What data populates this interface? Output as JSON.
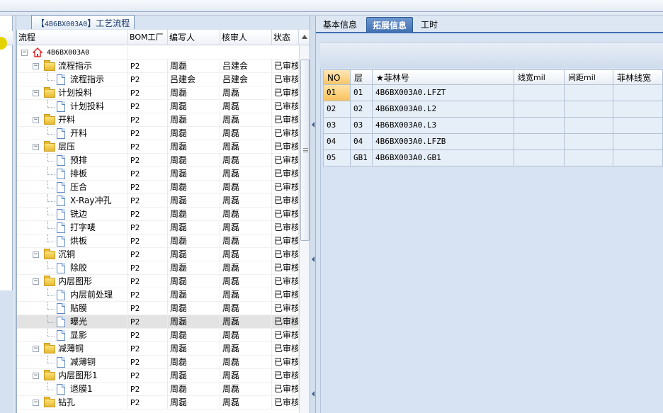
{
  "tree_tab": {
    "code": "4B6BX003A0",
    "title": "工艺流程",
    "prefix": "【",
    "suffix": "】"
  },
  "tree_columns": [
    "流程",
    "BOM工厂",
    "编写人",
    "核审人",
    "状态"
  ],
  "tree_root": "4B6BX003A0",
  "tree_rows": [
    {
      "label": "流程指示",
      "level": 1,
      "kind": "folder",
      "plant": "P2",
      "writer": "周磊",
      "reviewer": "吕建会",
      "status": "已审核"
    },
    {
      "label": "流程指示",
      "level": 2,
      "kind": "doc",
      "plant": "P2",
      "writer": "吕建会",
      "reviewer": "吕建会",
      "status": "已审核"
    },
    {
      "label": "计划投料",
      "level": 1,
      "kind": "folder",
      "plant": "P2",
      "writer": "周磊",
      "reviewer": "周磊",
      "status": "已审核"
    },
    {
      "label": "计划投料",
      "level": 2,
      "kind": "doc",
      "plant": "P2",
      "writer": "周磊",
      "reviewer": "周磊",
      "status": "已审核"
    },
    {
      "label": "开料",
      "level": 1,
      "kind": "folder",
      "plant": "P2",
      "writer": "周磊",
      "reviewer": "周磊",
      "status": "已审核"
    },
    {
      "label": "开料",
      "level": 2,
      "kind": "doc",
      "plant": "P2",
      "writer": "周磊",
      "reviewer": "周磊",
      "status": "已审核"
    },
    {
      "label": "层压",
      "level": 1,
      "kind": "folder",
      "plant": "P2",
      "writer": "周磊",
      "reviewer": "周磊",
      "status": "已审核"
    },
    {
      "label": "预排",
      "level": 2,
      "kind": "doc",
      "plant": "P2",
      "writer": "周磊",
      "reviewer": "周磊",
      "status": "已审核"
    },
    {
      "label": "排板",
      "level": 2,
      "kind": "doc",
      "plant": "P2",
      "writer": "周磊",
      "reviewer": "周磊",
      "status": "已审核"
    },
    {
      "label": "压合",
      "level": 2,
      "kind": "doc",
      "plant": "P2",
      "writer": "周磊",
      "reviewer": "周磊",
      "status": "已审核"
    },
    {
      "label": "X-Ray冲孔",
      "level": 2,
      "kind": "doc",
      "plant": "P2",
      "writer": "周磊",
      "reviewer": "周磊",
      "status": "已审核"
    },
    {
      "label": "铣边",
      "level": 2,
      "kind": "doc",
      "plant": "P2",
      "writer": "周磊",
      "reviewer": "周磊",
      "status": "已审核"
    },
    {
      "label": "打字唛",
      "level": 2,
      "kind": "doc",
      "plant": "P2",
      "writer": "周磊",
      "reviewer": "周磊",
      "status": "已审核"
    },
    {
      "label": "烘板",
      "level": 2,
      "kind": "doc",
      "plant": "P2",
      "writer": "周磊",
      "reviewer": "周磊",
      "status": "已审核"
    },
    {
      "label": "沉铜",
      "level": 1,
      "kind": "folder",
      "plant": "P2",
      "writer": "周磊",
      "reviewer": "周磊",
      "status": "已审核"
    },
    {
      "label": "除胶",
      "level": 2,
      "kind": "doc",
      "plant": "P2",
      "writer": "周磊",
      "reviewer": "周磊",
      "status": "已审核"
    },
    {
      "label": "内层图形",
      "level": 1,
      "kind": "folder",
      "plant": "P2",
      "writer": "周磊",
      "reviewer": "周磊",
      "status": "已审核"
    },
    {
      "label": "内层前处理",
      "level": 2,
      "kind": "doc",
      "plant": "P2",
      "writer": "周磊",
      "reviewer": "周磊",
      "status": "已审核"
    },
    {
      "label": "贴膜",
      "level": 2,
      "kind": "doc",
      "plant": "P2",
      "writer": "周磊",
      "reviewer": "周磊",
      "status": "已审核"
    },
    {
      "label": "曝光",
      "level": 2,
      "kind": "doc",
      "plant": "P2",
      "writer": "周磊",
      "reviewer": "周磊",
      "status": "已审核",
      "selected": true
    },
    {
      "label": "显影",
      "level": 2,
      "kind": "doc",
      "plant": "P2",
      "writer": "周磊",
      "reviewer": "周磊",
      "status": "已审核"
    },
    {
      "label": "减薄铜",
      "level": 1,
      "kind": "folder",
      "plant": "P2",
      "writer": "周磊",
      "reviewer": "周磊",
      "status": "已审核"
    },
    {
      "label": "减薄铜",
      "level": 2,
      "kind": "doc",
      "plant": "P2",
      "writer": "周磊",
      "reviewer": "周磊",
      "status": "已审核"
    },
    {
      "label": "内层图形1",
      "level": 1,
      "kind": "folder",
      "plant": "P2",
      "writer": "周磊",
      "reviewer": "周磊",
      "status": "已审核"
    },
    {
      "label": "退膜1",
      "level": 2,
      "kind": "doc",
      "plant": "P2",
      "writer": "周磊",
      "reviewer": "周磊",
      "status": "已审核"
    },
    {
      "label": "钻孔",
      "level": 1,
      "kind": "folder",
      "plant": "P2",
      "writer": "周磊",
      "reviewer": "周磊",
      "status": "已审核"
    }
  ],
  "right_tabs": [
    {
      "label": "基本信息",
      "active": false
    },
    {
      "label": "拓展信息",
      "active": true
    },
    {
      "label": "工时",
      "active": false
    }
  ],
  "grid_columns": [
    "NO",
    "层",
    "★菲林号",
    "线宽mil",
    "间距mil",
    "菲林线宽"
  ],
  "grid_rows": [
    {
      "no": "01",
      "layer": "01",
      "film": "4B6BX003A0.LFZT",
      "selected": true
    },
    {
      "no": "02",
      "layer": "02",
      "film": "4B6BX003A0.L2"
    },
    {
      "no": "03",
      "layer": "03",
      "film": "4B6BX003A0.L3"
    },
    {
      "no": "04",
      "layer": "04",
      "film": "4B6BX003A0.LFZB"
    },
    {
      "no": "05",
      "layer": "GB1",
      "film": "4B6BX003A0.GB1"
    }
  ],
  "icons": {
    "root": "home-icon",
    "folder": "folder-icon",
    "doc": "document-icon"
  },
  "colors": {
    "accent": "#3f6fb1",
    "selection": "#f8c15c",
    "grid_bg": "#e6eef8"
  }
}
